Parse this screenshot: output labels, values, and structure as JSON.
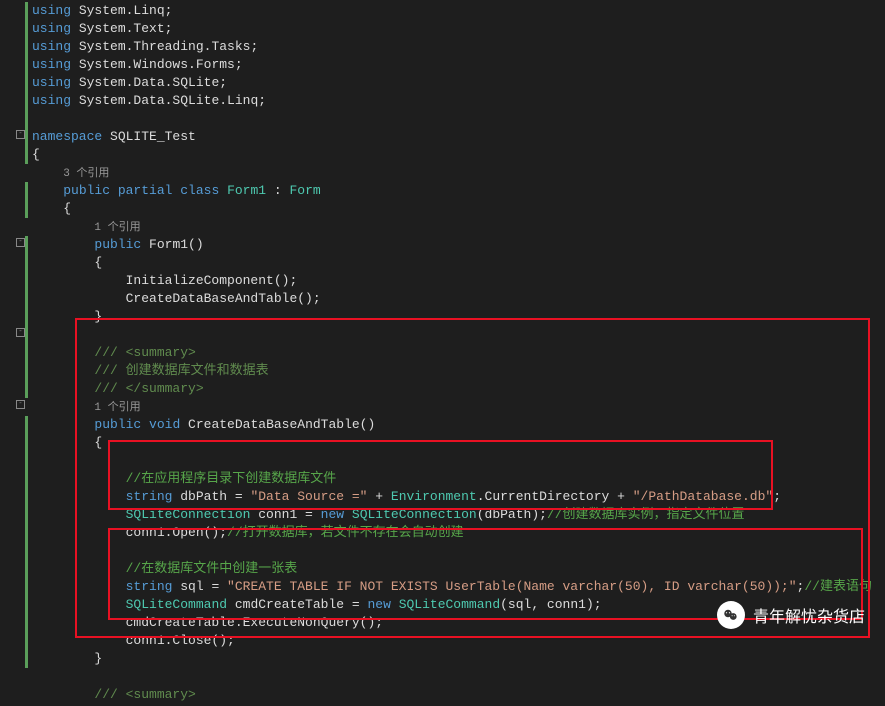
{
  "lines": {
    "l1": {
      "kw": "using",
      "ns": " System.Linq;"
    },
    "l2": {
      "kw": "using",
      "ns": " System.Text;"
    },
    "l3": {
      "kw": "using",
      "ns": " System.Threading.Tasks;"
    },
    "l4": {
      "kw": "using",
      "ns": " System.Windows.Forms;"
    },
    "l5": {
      "kw": "using",
      "ns": " System.Data.SQLite;"
    },
    "l6": {
      "kw": "using",
      "ns": " System.Data.SQLite.Linq;"
    },
    "l8": {
      "kw": "namespace",
      "name": " SQLITE_Test"
    },
    "l9": "{",
    "l10_ref": "3 个引用",
    "l11": {
      "p1": "public",
      "p2": " partial",
      "p3": " class",
      "p4": " Form1",
      "p5": " : ",
      "p6": "Form"
    },
    "l12": "    {",
    "l13_ref": "1 个引用",
    "l14": {
      "p1": "public",
      "p2": " Form1()"
    },
    "l15": "        {",
    "l16": "            InitializeComponent();",
    "l17": "            CreateDataBaseAndTable();",
    "l18": "        }",
    "l20": "/// <summary>",
    "l21": "/// 创建数据库文件和数据表",
    "l22": "/// </summary>",
    "l23_ref": "1 个引用",
    "l24": {
      "p1": "public",
      "p2": " void",
      "p3": " CreateDataBaseAndTable()"
    },
    "l25": "        {",
    "l27": "//在应用程序目录下创建数据库文件",
    "l28": {
      "p1": "string",
      "p2": " dbPath = ",
      "p3": "\"Data Source =\"",
      "p4": " + ",
      "p5": "Environment",
      "p6": ".CurrentDirectory + ",
      "p7": "\"/PathDatabase.db\"",
      "p8": ";"
    },
    "l29": {
      "p1": "SQLiteConnection",
      "p2": " conn1 = ",
      "p3": "new",
      "p4": " ",
      "p5": "SQLiteConnection",
      "p6": "(dbPath);",
      "p7": "//创建数据库实例，指定文件位置"
    },
    "l30": {
      "p1": "            conn1.Open();",
      "p2": "//打开数据库，若文件不存在会自动创建"
    },
    "l32": "//在数据库文件中创建一张表",
    "l33": {
      "p1": "string",
      "p2": " sql = ",
      "p3": "\"CREATE TABLE IF NOT EXISTS UserTable(Name varchar(50), ID varchar(50));\"",
      "p4": ";",
      "p5": "//建表语句"
    },
    "l34": {
      "p1": "SQLiteCommand",
      "p2": " cmdCreateTable = ",
      "p3": "new",
      "p4": " ",
      "p5": "SQLiteCommand",
      "p6": "(sql, conn1);"
    },
    "l35": "            cmdCreateTable.ExecuteNonQuery();",
    "l36": "            conn1.Close();",
    "l37": "        }",
    "l39": "/// <summary>"
  },
  "watermark": "青年解忧杂货店"
}
